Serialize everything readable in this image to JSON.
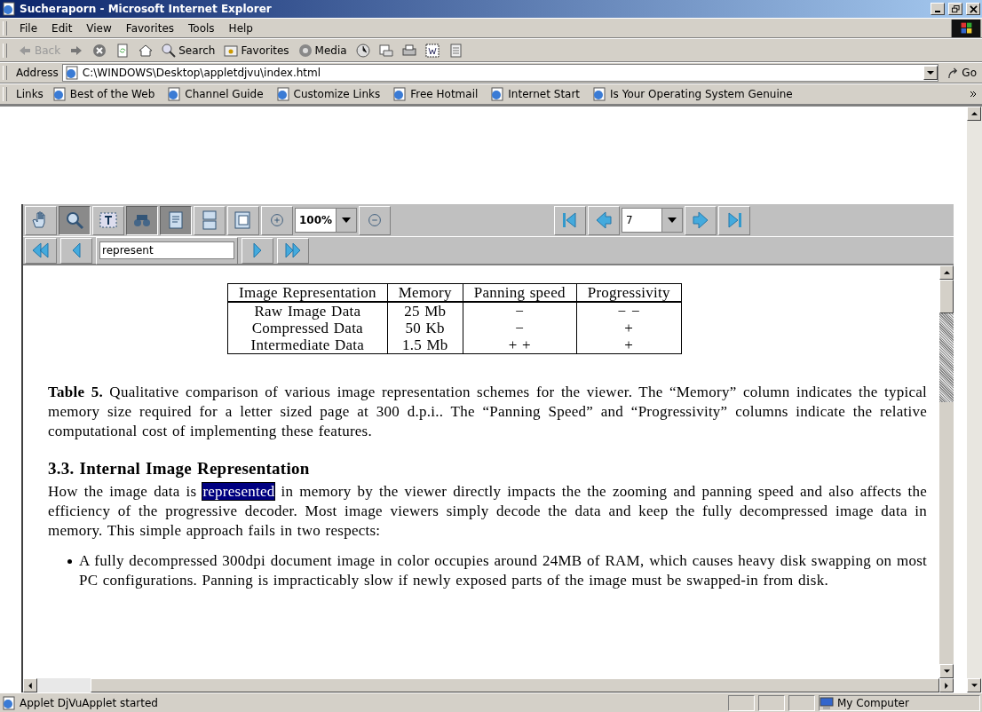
{
  "window": {
    "title": "Sucheraporn - Microsoft Internet Explorer"
  },
  "menu": [
    "File",
    "Edit",
    "View",
    "Favorites",
    "Tools",
    "Help"
  ],
  "toolbar": [
    {
      "kind": "back",
      "label": "Back",
      "disabled": true
    },
    {
      "kind": "forward"
    },
    {
      "kind": "stop"
    },
    {
      "kind": "refresh"
    },
    {
      "kind": "home"
    },
    {
      "kind": "search",
      "label": "Search"
    },
    {
      "kind": "favorites",
      "label": "Favorites"
    },
    {
      "kind": "media",
      "label": "Media"
    },
    {
      "kind": "history"
    },
    {
      "kind": "mail"
    },
    {
      "kind": "print"
    },
    {
      "kind": "edit"
    },
    {
      "kind": "discuss"
    }
  ],
  "address": {
    "label": "Address",
    "value": "C:\\WINDOWS\\Desktop\\appletdjvu\\index.html",
    "go": "Go"
  },
  "links": {
    "label": "Links",
    "items": [
      "Best of the Web",
      "Channel Guide",
      "Customize Links",
      "Free Hotmail",
      "Internet Start",
      "Is Your Operating System Genuine"
    ]
  },
  "applet": {
    "tools": [
      {
        "kind": "hand",
        "selected": false
      },
      {
        "kind": "zoom",
        "selected": true
      },
      {
        "kind": "text",
        "selected": false
      },
      {
        "kind": "find",
        "selected": true
      },
      {
        "kind": "page",
        "selected": true
      },
      {
        "kind": "continuous",
        "selected": false
      },
      {
        "kind": "facing",
        "selected": false
      }
    ],
    "zoom": "100%",
    "page": "7",
    "find": "represent",
    "document": {
      "table": {
        "columns": [
          "Image Representation",
          "Memory",
          "Panning speed",
          "Progressivity"
        ],
        "rows": [
          [
            "Raw Image Data",
            "25 Mb",
            "−",
            "− −"
          ],
          [
            "Compressed Data",
            "50 Kb",
            "−",
            "+"
          ],
          [
            "Intermediate Data",
            "1.5 Mb",
            "+ +",
            "+"
          ]
        ]
      },
      "caption": "**Table 5.**  Qualitative comparison of various image representation schemes for the viewer.  The “Memory” column indicates the typical memory size required for a letter sized page at 300 d.p.i..  The “Panning Speed” and “Progressivity” columns indicate the relative computational cost of implementing these features.",
      "heading": "3.3.  Internal Image Representation",
      "paragraph": {
        "before": "How the image data is ",
        "highlight": "represented",
        "after": " in memory by the viewer directly impacts the the zooming and panning speed and also affects the efficiency of the progressive decoder. Most image viewers simply decode the data and keep the fully decompressed image data in memory. This simple approach fails in two respects:"
      },
      "bullets": [
        "A fully decompressed 300dpi document image in color occupies around 24MB of RAM, which causes heavy disk swapping on most PC configurations. Panning is impracticably slow if newly exposed parts of the image must be swapped-in from disk."
      ]
    }
  },
  "status": {
    "text": "Applet DjVuApplet started",
    "zone": "My Computer"
  }
}
